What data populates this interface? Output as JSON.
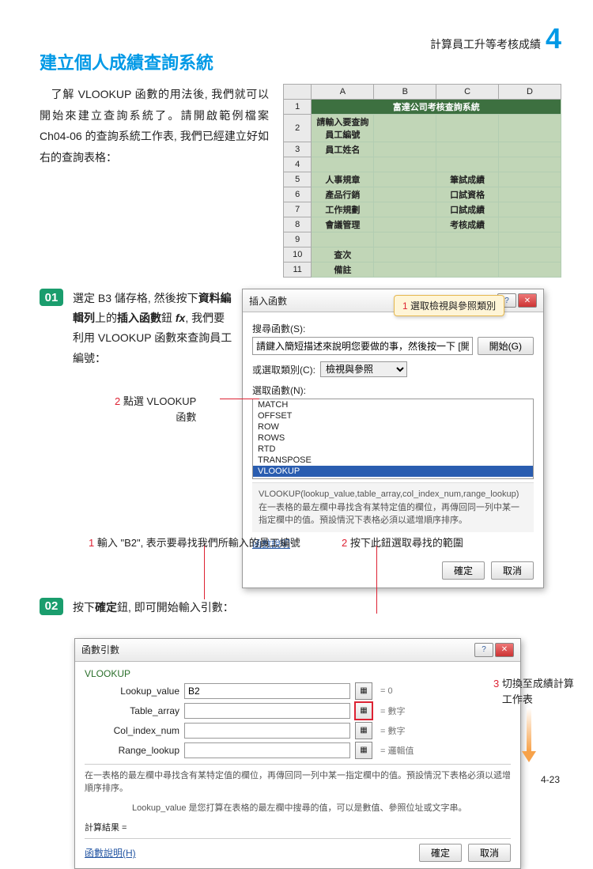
{
  "chapter": {
    "label": "計算員工升等考核成績",
    "num": "4"
  },
  "title": "建立個人成績查詢系統",
  "intro": "　了解 VLOOKUP 函數的用法後, 我們就可以開始來建立查詢系統了。請開啟範例檔案 Ch04-06 的查詢系統工作表, 我們已經建立好如右的查詢表格：",
  "worksheet": {
    "cols": [
      "A",
      "B",
      "C",
      "D"
    ],
    "title": "富達公司考核查詢系統",
    "rows": [
      [
        "請輸入要查詢員工編號",
        "",
        "",
        ""
      ],
      [
        "員工姓名",
        "",
        "",
        ""
      ],
      [
        "",
        "",
        "",
        ""
      ],
      [
        "人事規章",
        "",
        "筆試成績",
        ""
      ],
      [
        "產品行銷",
        "",
        "口試資格",
        ""
      ],
      [
        "工作規劃",
        "",
        "口試成績",
        ""
      ],
      [
        "會議管理",
        "",
        "考核成績",
        ""
      ],
      [
        "",
        "",
        "",
        ""
      ],
      [
        "查次",
        "",
        "",
        ""
      ],
      [
        "備註",
        "",
        "",
        ""
      ]
    ]
  },
  "step1": {
    "num": "01",
    "text1": "選定 B3 儲存格, 然後按下",
    "bold1": "資料編輯列",
    "text2": "上的",
    "bold2": "插入函數",
    "text3": "鈕 ",
    "fx": "fx",
    "text4": ", 我們要利用 VLOOKUP 函數來查詢員工編號：",
    "anno2": "點選 ",
    "anno2b": "VLOOKUP",
    "anno2c": "函數"
  },
  "dialog1": {
    "title": "插入函數",
    "searchLabel": "搜尋函數(S):",
    "searchValue": "請鍵入簡短描述來說明您要做的事，然後按一下 [開始]",
    "startBtn": "開始(G)",
    "catLabel": "或選取類別(C):",
    "catValue": "檢視與參照",
    "callout1_num": "1",
    "callout1_a": "選取",
    "callout1_b": "檢視與參照",
    "callout1_c": "類別",
    "selectLabel": "選取函數(N):",
    "list": [
      "MATCH",
      "OFFSET",
      "ROW",
      "ROWS",
      "RTD",
      "TRANSPOSE",
      "VLOOKUP"
    ],
    "desc1": "VLOOKUP(lookup_value,table_array,col_index_num,range_lookup)",
    "desc2": "在一表格的最左欄中尋找含有某特定值的欄位，再傳回同一列中某一指定欄中的值。預設情況下表格必須以遞增順序排序。",
    "helpLink": "函數說明",
    "ok": "確定",
    "cancel": "取消"
  },
  "step2": {
    "num": "02",
    "text": "按下確定鈕, 即可開始輸入引數：",
    "anno1": "輸入 \"B2\", 表示要尋找我們所輸入的員工編號",
    "anno2": "按下此鈕選取尋找的範圍",
    "anno3a": "切換至",
    "anno3b": "成績計算",
    "anno3c": "工作表"
  },
  "dialog2": {
    "title": "函數引數",
    "func": "VLOOKUP",
    "args": [
      {
        "name": "Lookup_value",
        "val": "B2",
        "eq": "= 0",
        "hl": false
      },
      {
        "name": "Table_array",
        "val": "",
        "eq": "= 數字",
        "hl": true
      },
      {
        "name": "Col_index_num",
        "val": "",
        "eq": "= 數字",
        "hl": false
      },
      {
        "name": "Range_lookup",
        "val": "",
        "eq": "= 邏輯值",
        "hl": false
      }
    ],
    "desc1": "在一表格的最左欄中尋找含有某特定值的欄位，再傳回同一列中某一指定欄中的值。預設情況下表格必須以遞增順序排序。",
    "argHelp": "Lookup_value 是您打算在表格的最左欄中搜尋的值，可以是數值、參照位址或文字串。",
    "resultLabel": "計算結果 =",
    "helpLink": "函數說明(H)",
    "ok": "確定",
    "cancel": "取消"
  },
  "pageNum": "4-23"
}
